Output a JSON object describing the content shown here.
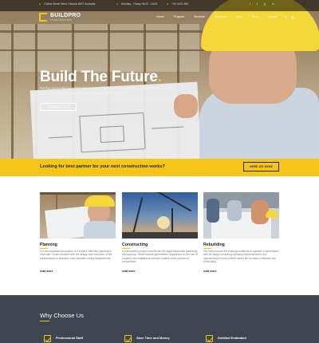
{
  "topbar": {
    "address": "Collins Street West, Victoria 8007 Australia",
    "hours": "Monday - Friday 08:00 - 18:00",
    "phone": "+00 0123 456"
  },
  "header": {
    "brand": "BUILDPRO",
    "tagline": "CONSTRUCTION",
    "nav": [
      "Home",
      "Projects",
      "Services",
      "About Us",
      "Blog",
      "Shop",
      "Contact"
    ]
  },
  "hero": {
    "title": "Build The Future",
    "title_dot": ".",
    "subtitle": "For the successful execution of a project, effective planning is essential. Our team ensure the building continues to perform in accordance with its design.",
    "cta": "CONTACT US"
  },
  "cta_bar": {
    "text": "Looking for best partner for your next construction works?",
    "button": "HIRE US NOW"
  },
  "services": [
    {
      "title": "Planning",
      "desc": "For the successful execution of a project, effective planning is essential. Those involved with the design and execution of the infrastructure in question must consider zoning requirements.",
      "more": "read more"
    },
    {
      "title": "Constructing",
      "desc": "A construction project must fit into the legal framework governing the property. These include government regulations on the use of property and obligations that are created in the process of construction.",
      "more": "read more"
    },
    {
      "title": "Rebuilding",
      "desc": "Our team ensure the building continues to operate in accordance with its design, including replacing elements which are approaching the end of their useful life to make it effective and functioning.",
      "more": "read more"
    }
  ],
  "why": {
    "title": "Why Choose Us",
    "items": [
      "Professional Staff",
      "Save Time and Money",
      "Detailed Estimated"
    ]
  },
  "colors": {
    "accent": "#f5c518",
    "dark": "#3f4650"
  },
  "icons": {
    "social": [
      "facebook-icon",
      "twitter-icon",
      "google-plus-icon",
      "linkedin-icon"
    ],
    "search": "search-icon",
    "cart": "cart-icon"
  }
}
